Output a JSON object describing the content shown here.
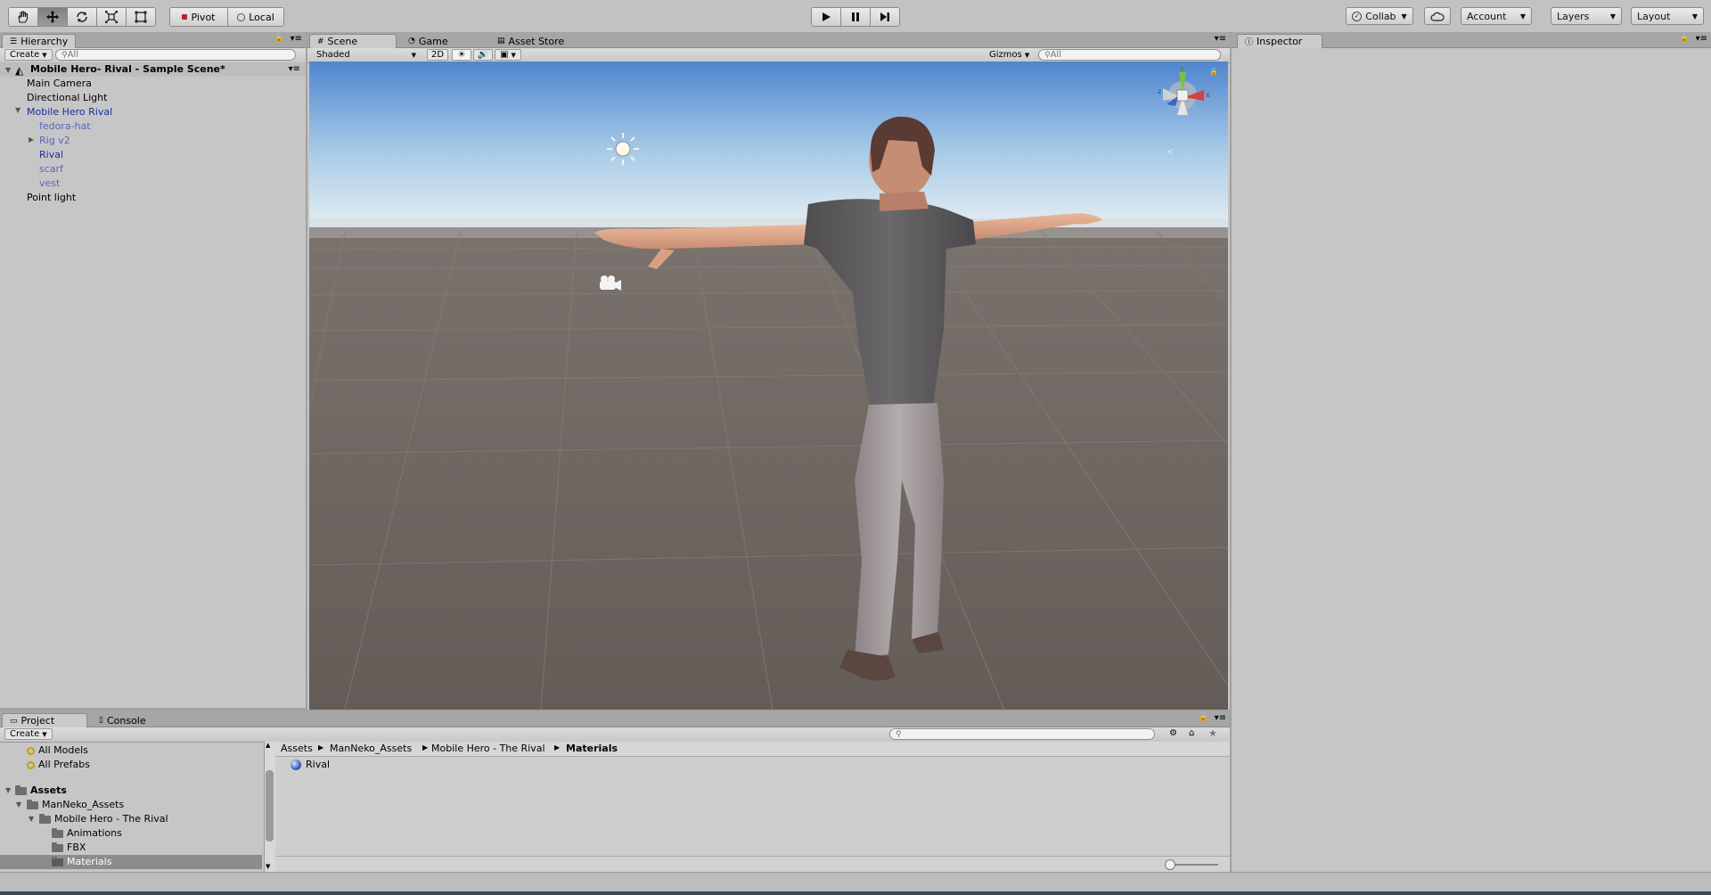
{
  "toolbar": {
    "pivot_label": "Pivot",
    "local_label": "Local",
    "collab_label": "Collab",
    "account_label": "Account",
    "layers_label": "Layers",
    "layout_label": "Layout"
  },
  "hierarchy": {
    "tab_label": "Hierarchy",
    "create_label": "Create",
    "search_placeholder": "All",
    "scene_name": "Mobile Hero- Rival - Sample Scene*",
    "items": [
      {
        "label": "Main Camera"
      },
      {
        "label": "Directional Light"
      },
      {
        "label": "Mobile Hero Rival"
      },
      {
        "label": "fedora-hat"
      },
      {
        "label": "Rig v2"
      },
      {
        "label": "Rival"
      },
      {
        "label": "scarf"
      },
      {
        "label": "vest"
      },
      {
        "label": "Point light"
      }
    ]
  },
  "scene": {
    "tabs": [
      {
        "label": "Scene"
      },
      {
        "label": "Game"
      },
      {
        "label": "Asset Store"
      }
    ],
    "shading_mode": "Shaded",
    "mode_2d_label": "2D",
    "gizmos_label": "Gizmos",
    "search_placeholder": "All",
    "axis_x": "x",
    "axis_y": "y",
    "axis_z": "z"
  },
  "inspector": {
    "tab_label": "Inspector"
  },
  "project": {
    "tabs": [
      {
        "label": "Project"
      },
      {
        "label": "Console"
      }
    ],
    "create_label": "Create",
    "favorites": [
      {
        "label": "All Models"
      },
      {
        "label": "All Prefabs"
      }
    ],
    "tree": [
      {
        "label": "Assets"
      },
      {
        "label": "ManNeko_Assets"
      },
      {
        "label": "Mobile Hero - The Rival"
      },
      {
        "label": "Animations"
      },
      {
        "label": "FBX"
      },
      {
        "label": "Materials"
      }
    ],
    "breadcrumb": [
      {
        "label": "Assets"
      },
      {
        "label": "ManNeko_Assets"
      },
      {
        "label": "Mobile Hero - The Rival"
      },
      {
        "label": "Materials"
      }
    ],
    "files": [
      {
        "label": "Rival"
      }
    ]
  },
  "colors": {
    "accent_blue": "#1b2f9a",
    "selection": "#8c8c8c",
    "sky_top": "#4f86cf",
    "ground": "#6a625d"
  }
}
